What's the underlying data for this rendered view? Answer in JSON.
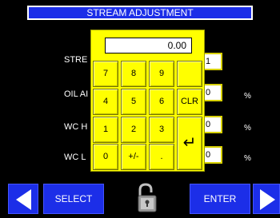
{
  "title": "STREAM ADJUSTMENT",
  "labels": {
    "stream": "STRE",
    "oil": "OIL AI",
    "wc_high": "WC H",
    "wc_low": "WC L"
  },
  "values": {
    "stream": "1",
    "oil": "0",
    "wc_high": "0",
    "wc_low": "0"
  },
  "units": {
    "oil": "%",
    "wc_high": "%",
    "wc_low": "%"
  },
  "keypad": {
    "display": "0.00",
    "keys": {
      "k7": "7",
      "k8": "8",
      "k9": "9",
      "k4": "4",
      "k5": "5",
      "k6": "6",
      "clr": "CLR",
      "k1": "1",
      "k2": "2",
      "k3": "3",
      "k0": "0",
      "plusminus": "+/-",
      "dot": ".",
      "enter": "↵"
    }
  },
  "bottom": {
    "select": "SELECT",
    "enter": "ENTER"
  },
  "colors": {
    "title_bg": "#1c2ee8",
    "keypad_yellow": "#ffff00",
    "nav_blue": "#1c2ee8",
    "value_border": "#d8d100"
  },
  "icons": {
    "lock": "unlocked-padlock-icon",
    "prev": "left-arrow-icon",
    "next": "right-arrow-icon"
  }
}
